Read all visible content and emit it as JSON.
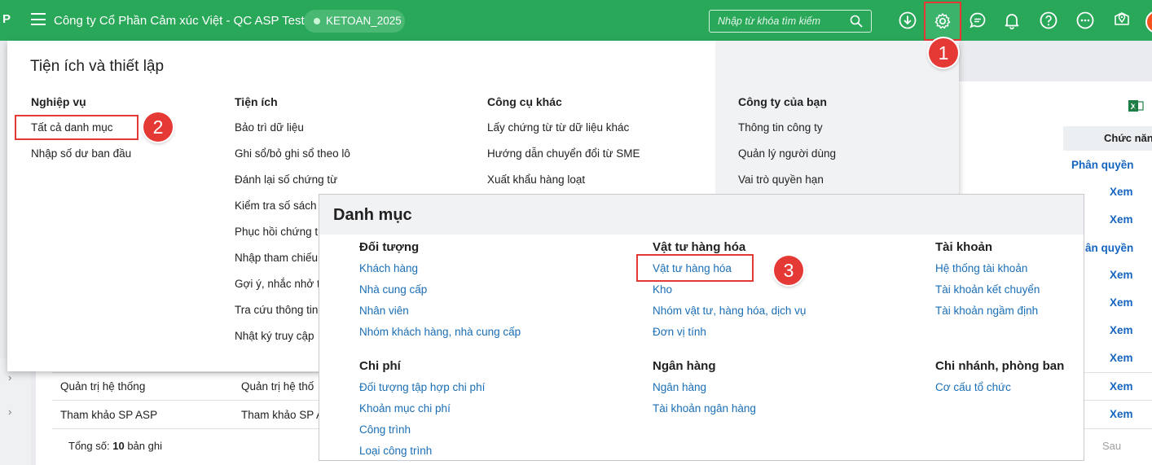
{
  "topbar": {
    "app_letter": "P",
    "company": "Công ty Cổ Phần Cảm xúc Việt - QC ASP Test",
    "database": "KETOAN_2025",
    "search_placeholder": "Nhập từ khóa tìm kiếm",
    "icons": [
      "download-icon",
      "gear-icon",
      "chat-icon",
      "bell-icon",
      "help-icon",
      "more-icon",
      "map-pin-icon"
    ]
  },
  "callouts": {
    "one": "1",
    "two": "2",
    "three": "3"
  },
  "settings_menu": {
    "title": "Tiện ích và thiết lập",
    "nghiep_vu": {
      "heading": "Nghiệp vụ",
      "items": [
        "Tất cả danh mục",
        "Nhập số dư ban đầu"
      ]
    },
    "tien_ich": {
      "heading": "Tiện ích",
      "items": [
        "Bảo trì dữ liệu",
        "Ghi sổ/bỏ ghi sổ theo lô",
        "Đánh lại số chứng từ",
        "Kiểm tra số sách",
        "Phục hồi chứng t",
        "Nhập tham chiếu",
        "Gợi ý, nhắc nhở t",
        "Tra cứu thông tin",
        "Nhật ký truy cập"
      ]
    },
    "cong_cu_khac": {
      "heading": "Công cụ khác",
      "items": [
        "Lấy chứng từ từ dữ liệu khác",
        "Hướng dẫn chuyển đổi từ SME",
        "Xuất khẩu hàng loạt"
      ]
    },
    "cong_ty": {
      "heading": "Công ty của bạn",
      "items": [
        "Thông tin công ty",
        "Quản lý người dùng",
        "Vai trò quyền hạn"
      ]
    }
  },
  "danh_muc": {
    "title": "Danh mục",
    "doi_tuong": {
      "heading": "Đối tượng",
      "items": [
        "Khách hàng",
        "Nhà cung cấp",
        "Nhân viên",
        "Nhóm khách hàng, nhà cung cấp"
      ]
    },
    "chi_phi": {
      "heading": "Chi phí",
      "items": [
        "Đối tượng tập hợp chi phí",
        "Khoản mục chi phí",
        "Công trình",
        "Loại công trình"
      ]
    },
    "vat_tu": {
      "heading": "Vật tư hàng hóa",
      "items": [
        "Vật tư hàng hóa",
        "Kho",
        "Nhóm vật tư, hàng hóa, dịch vụ",
        "Đơn vị tính"
      ]
    },
    "ngan_hang": {
      "heading": "Ngân hàng",
      "items": [
        "Ngân hàng",
        "Tài khoản ngân hàng"
      ]
    },
    "tai_khoan": {
      "heading": "Tài khoản",
      "items": [
        "Hệ thống tài khoản",
        "Tài khoản kết chuyển",
        "Tài khoản ngầm định"
      ]
    },
    "chi_nhanh": {
      "heading": "Chi nhánh, phòng ban",
      "items": [
        "Cơ cấu tổ chức"
      ]
    }
  },
  "background": {
    "column_header": "Chức năn",
    "actions": [
      "Phân quyền",
      "Xem",
      "Xem",
      "ân quyền",
      "Xem",
      "Xem",
      "Xem",
      "Xem",
      "Xem",
      "Xem"
    ],
    "rows": [
      {
        "name": "Quản trị hệ thống",
        "desc": "Quản trị hệ thố"
      },
      {
        "name": "Tham khảo SP ASP",
        "desc": "Tham khảo SP A"
      }
    ],
    "total_label": "Tổng số:",
    "total_value": "10",
    "total_unit": "bản ghi",
    "next": "Sau"
  }
}
